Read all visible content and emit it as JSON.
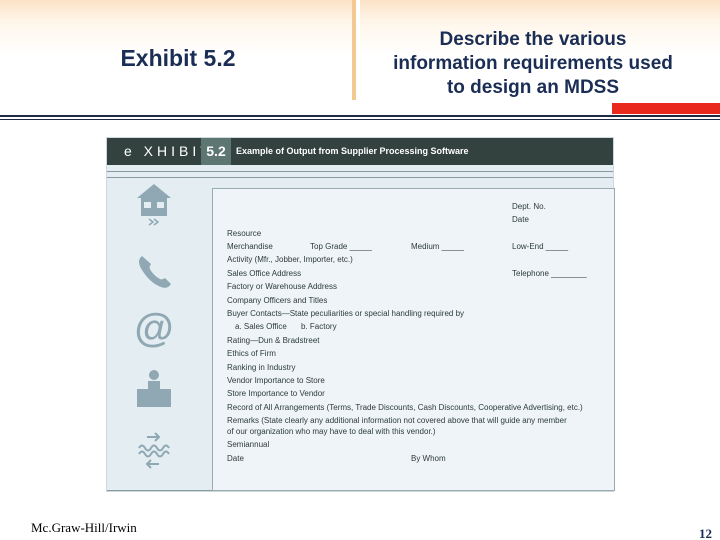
{
  "header": {
    "left_title": "Exhibit 5.2",
    "right_title_lines": [
      "Describe the various",
      "information requirements used",
      "to design an MDSS"
    ]
  },
  "exhibit": {
    "logo": "e XHIBIT",
    "number": "5.2",
    "caption": "Example of Output from Supplier Processing Software",
    "icons": [
      "house-icon",
      "phone-icon",
      "at-sign-icon",
      "person-at-desk-icon",
      "exchange-arrows-icon"
    ],
    "icon_at_glyph": "@",
    "form": {
      "dept_no": "Dept. No.",
      "date_top": "Date",
      "resource": "Resource",
      "merchandise": "Merchandise",
      "top_grade": "Top Grade _____",
      "medium": "Medium _____",
      "low_end": "Low-End _____",
      "activity": "Activity (Mfr., Jobber, Importer, etc.)",
      "sales_office_address": "Sales Office Address",
      "telephone": "Telephone ________",
      "factory_address": "Factory or Warehouse Address",
      "company_officers": "Company Officers and Titles",
      "buyer_contacts": "Buyer Contacts—State peculiarities or special handling required by",
      "sales_office_sub": "a. Sales Office",
      "factory_sub": "b. Factory",
      "rating": "Rating—Dun & Bradstreet",
      "ethics": "Ethics of Firm",
      "ranking": "Ranking in Industry",
      "vendor_importance": "Vendor Importance to Store",
      "store_importance": "Store Importance to Vendor",
      "record_arrangements": "Record of All Arrangements (Terms, Trade Discounts, Cash Discounts, Cooperative Advertising, etc.)",
      "remarks_1": "Remarks (State clearly any additional information not covered above that will guide any member",
      "remarks_2": "of our organization who may have to deal with this vendor.)",
      "semiannual": "Semiannual",
      "date_bottom": "Date",
      "by_whom": "By Whom"
    }
  },
  "footer": {
    "publisher": "Mc.Graw-Hill/Irwin",
    "page_number": "12"
  },
  "colors": {
    "title_navy": "#1a2d55",
    "accent_red": "#e8291c",
    "exhibit_bar": "#33413f",
    "exhibit_panel": "#e4eef2"
  }
}
